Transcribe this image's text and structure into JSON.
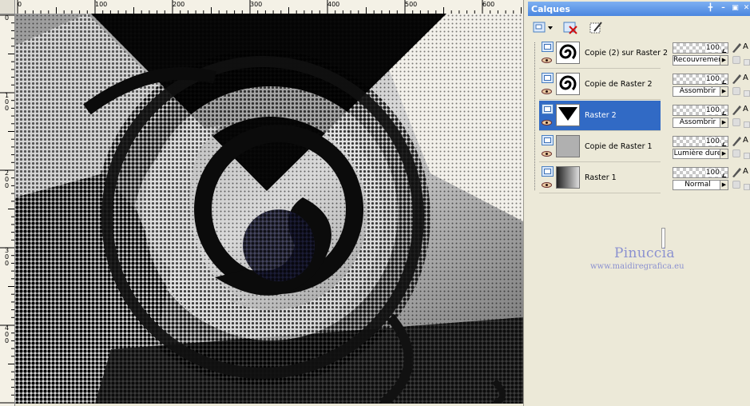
{
  "ruler": {
    "top_labels": [
      "0",
      "100",
      "200",
      "300",
      "400",
      "500",
      "600"
    ],
    "left_labels": [
      "0",
      "100",
      "200",
      "300",
      "400"
    ]
  },
  "palette": {
    "title": "Calques",
    "titlebar_buttons": [
      "pin-icon",
      "minimize-icon",
      "restore-icon",
      "close-icon"
    ],
    "toolbar_icons": [
      "new-layer-icon",
      "delete-layer-icon",
      "layer-properties-icon"
    ]
  },
  "layers": [
    {
      "name": "Copie (2) sur Raster 2",
      "opacity": "100",
      "blend": "Recouvrement",
      "selected": false,
      "thumb": "spiral"
    },
    {
      "name": "Copie de Raster 2",
      "opacity": "100",
      "blend": "Assombrir",
      "selected": false,
      "thumb": "spiral"
    },
    {
      "name": "Raster 2",
      "opacity": "100",
      "blend": "Assombrir",
      "selected": true,
      "thumb": "triangle"
    },
    {
      "name": "Copie de Raster 1",
      "opacity": "100",
      "blend": "Lumière dure",
      "selected": false,
      "thumb": "gray"
    },
    {
      "name": "Raster 1",
      "opacity": "100",
      "blend": "Normal",
      "selected": false,
      "thumb": "gradient"
    }
  ],
  "lock_label": "A",
  "watermark": {
    "title": "Pinuccia",
    "url": "www.maidiregrafica.eu"
  },
  "colors": {
    "selection": "#316ac5",
    "titlebar": "#4a86df",
    "watermark": "#8b91d0"
  }
}
